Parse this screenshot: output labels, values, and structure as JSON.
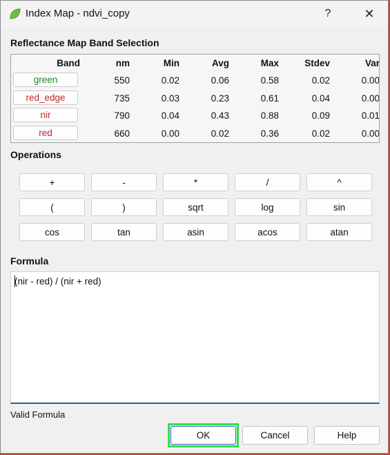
{
  "window": {
    "title": "Index Map - ndvi_copy",
    "help_label": "?",
    "close_label": "✕"
  },
  "bands_section": {
    "title": "Reflectance Map Band Selection",
    "headers": [
      "Band",
      "nm",
      "Min",
      "Avg",
      "Max",
      "Stdev",
      "Var"
    ],
    "rows": [
      {
        "band": "green",
        "color": "#1f8a2a",
        "nm": "550",
        "min": "0.02",
        "avg": "0.06",
        "max": "0.58",
        "stdev": "0.02",
        "var": "0.00"
      },
      {
        "band": "red_edge",
        "color": "#c0262b",
        "nm": "735",
        "min": "0.03",
        "avg": "0.23",
        "max": "0.61",
        "stdev": "0.04",
        "var": "0.00"
      },
      {
        "band": "nir",
        "color": "#c0262b",
        "nm": "790",
        "min": "0.04",
        "avg": "0.43",
        "max": "0.88",
        "stdev": "0.09",
        "var": "0.01"
      },
      {
        "band": "red",
        "color": "#c0262b",
        "nm": "660",
        "min": "0.00",
        "avg": "0.02",
        "max": "0.36",
        "stdev": "0.02",
        "var": "0.00"
      }
    ]
  },
  "operations": {
    "title": "Operations",
    "buttons": [
      "+",
      "-",
      "*",
      "/",
      "^",
      "(",
      ")",
      "sqrt",
      "log",
      "sin",
      "cos",
      "tan",
      "asin",
      "acos",
      "atan"
    ]
  },
  "formula": {
    "title": "Formula",
    "value": "(nir - red) / (nir + red)",
    "status": "Valid Formula"
  },
  "actions": {
    "ok_label": "OK",
    "cancel_label": "Cancel",
    "help_label": "Help"
  },
  "colors": {
    "accent": "#1f5fa8",
    "ok_highlight": "#2ee04a",
    "app_icon": "#6fbf3a"
  },
  "icons": {
    "app": "leaf-icon",
    "close": "close-icon",
    "help": "help-icon"
  }
}
